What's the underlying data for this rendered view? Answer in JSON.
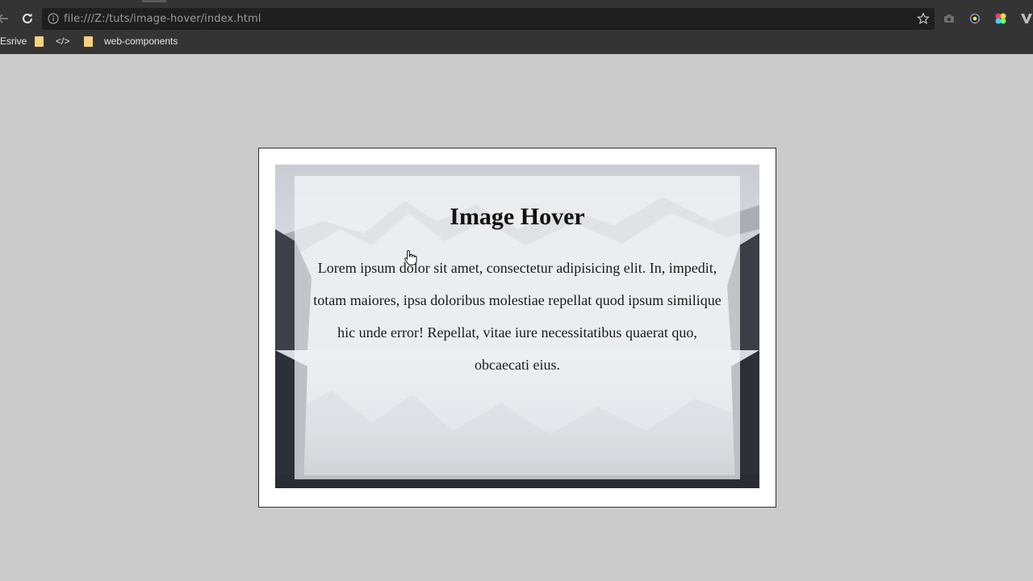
{
  "browser": {
    "url": "file:///Z:/tuts/image-hover/index.html",
    "bookmarks": [
      {
        "label": "Esrive"
      },
      {
        "label": "</>"
      },
      {
        "label": "web-components"
      }
    ]
  },
  "card": {
    "title": "Image Hover",
    "text": "Lorem ipsum dolor sit amet, consectetur adipisicing elit. In, impedit, totam maiores, ipsa doloribus molestiae repellat quod ipsum similique hic unde error! Repellat, vitae iure necessitatibus quaerat quo, obcaecati eius."
  },
  "colors": {
    "page_background": "#cbcbcb",
    "chrome": "#343434",
    "omnibox": "#1f1f1f"
  }
}
